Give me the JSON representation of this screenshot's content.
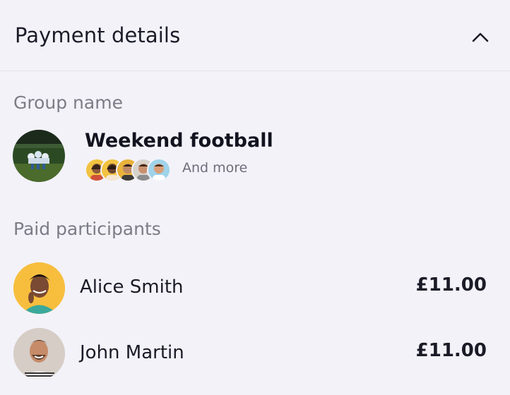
{
  "header": {
    "title": "Payment details",
    "collapse_icon": "chevron-up-icon"
  },
  "group": {
    "section_label": "Group name",
    "name": "Weekend football",
    "more_label": "And more"
  },
  "participants": {
    "section_label": "Paid participants",
    "items": [
      {
        "name": "Alice Smith",
        "amount": "£11.00"
      },
      {
        "name": "John Martin",
        "amount": "£11.00"
      }
    ]
  },
  "colors": {
    "background": "#f3f2f9",
    "title_text": "#1b1c28",
    "muted_text": "#7c7c86",
    "divider": "#e3e2ec"
  }
}
